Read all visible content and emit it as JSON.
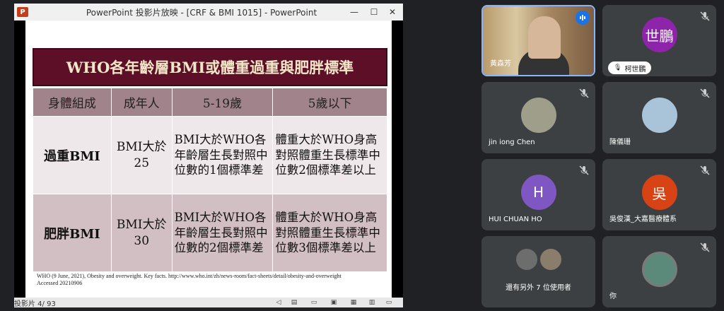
{
  "ppt": {
    "title": "PowerPoint 投影片放映 - [CRF & BMI 1015] - PowerPoint",
    "logo": "P",
    "minimize": "—",
    "maximize": "☐",
    "close": "✕",
    "slide_title": "WHO各年齡層BMI或體重過重與肥胖標準",
    "table": {
      "headers": [
        "身體組成",
        "成年人",
        "5-19歲",
        "5歲以下"
      ],
      "rows": [
        {
          "label": "過重BMI",
          "adult": "BMI大於25",
          "age5_19": "BMI大於WHO各年齡層生長對照中位數的1個標準差",
          "under5": "體重大於WHO身高對照體重生長標準中位數2個標準差以上"
        },
        {
          "label": "肥胖BMI",
          "adult": "BMI大於30",
          "age5_19": "BMI大於WHO各年齡層生長對照中位數的2個標準差",
          "under5": "體重大於WHO身高對照體重生長標準中位數3個標準差以上"
        }
      ]
    },
    "citation_line1": "WHO (9 June, 2021), Obesity and overweight. Key facts. http://www.who.int/zh/news-room/fact-sheets/detail/obesity-and-overweight",
    "citation_line2": "Accessed 20210906",
    "slide_counter": "投影片 4/ 93"
  },
  "meet": {
    "tiles": [
      {
        "name": "黃森芳",
        "type": "video",
        "speaking": true
      },
      {
        "name": "柯世鵬",
        "avatar_text": "世鵬",
        "avatar_color": "#8e24aa",
        "muted": true
      },
      {
        "name": "jin iong Chen",
        "type": "photo",
        "muted": true
      },
      {
        "name": "陳儀珊",
        "type": "photo",
        "muted": true
      },
      {
        "name": "HUI CHUAN HO",
        "avatar_text": "H",
        "avatar_color": "#7e57c2",
        "muted": true
      },
      {
        "name": "吳俊漢_大嘉醫療體系",
        "avatar_text": "吳",
        "avatar_color": "#d84315",
        "muted": true
      },
      {
        "name": "還有另外 7 位使用者",
        "type": "group"
      },
      {
        "name": "你",
        "type": "self",
        "muted": true
      }
    ]
  },
  "colors": {
    "banner": "#5c0f26",
    "header_row": "#a0838b",
    "row_light": "#efe8ea",
    "row_dark": "#d2bfc4",
    "meet_bg": "#202124",
    "tile_bg": "#3c4043",
    "active_border": "#8ab4f8"
  },
  "icons": [
    "powerpoint-logo-icon",
    "minimize-icon",
    "maximize-icon",
    "close-icon",
    "mic-off-icon",
    "speaking-icon",
    "mic-off-small-icon"
  ]
}
